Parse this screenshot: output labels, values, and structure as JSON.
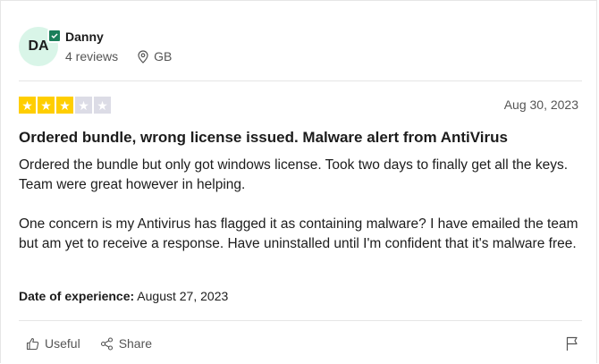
{
  "reviewer": {
    "initials": "DA",
    "name": "Danny",
    "review_count": "4 reviews",
    "country": "GB"
  },
  "rating": {
    "value": 3,
    "max": 5
  },
  "review": {
    "date": "Aug 30, 2023",
    "title": "Ordered bundle, wrong license issued. Malware alert from AntiVirus",
    "paragraphs": [
      "Ordered the bundle but only got windows license. Took two days to finally get all the keys. Team were great however in helping.",
      "One concern is my Antivirus has flagged it as containing malware? I have emailed the team but am yet to receive a response. Have uninstalled until I'm confident that it's malware free."
    ],
    "experience_label": "Date of experience:",
    "experience_date": "August 27, 2023"
  },
  "actions": {
    "useful_label": "Useful",
    "share_label": "Share"
  },
  "colors": {
    "star_filled": "#ffce00",
    "star_empty": "#dcdce6",
    "avatar_bg": "#d9f5e8",
    "verified": "#1a7f5a"
  },
  "icons": [
    "verified-badge-icon",
    "location-pin-icon",
    "star-icon",
    "thumbs-up-icon",
    "share-icon",
    "flag-icon"
  ]
}
